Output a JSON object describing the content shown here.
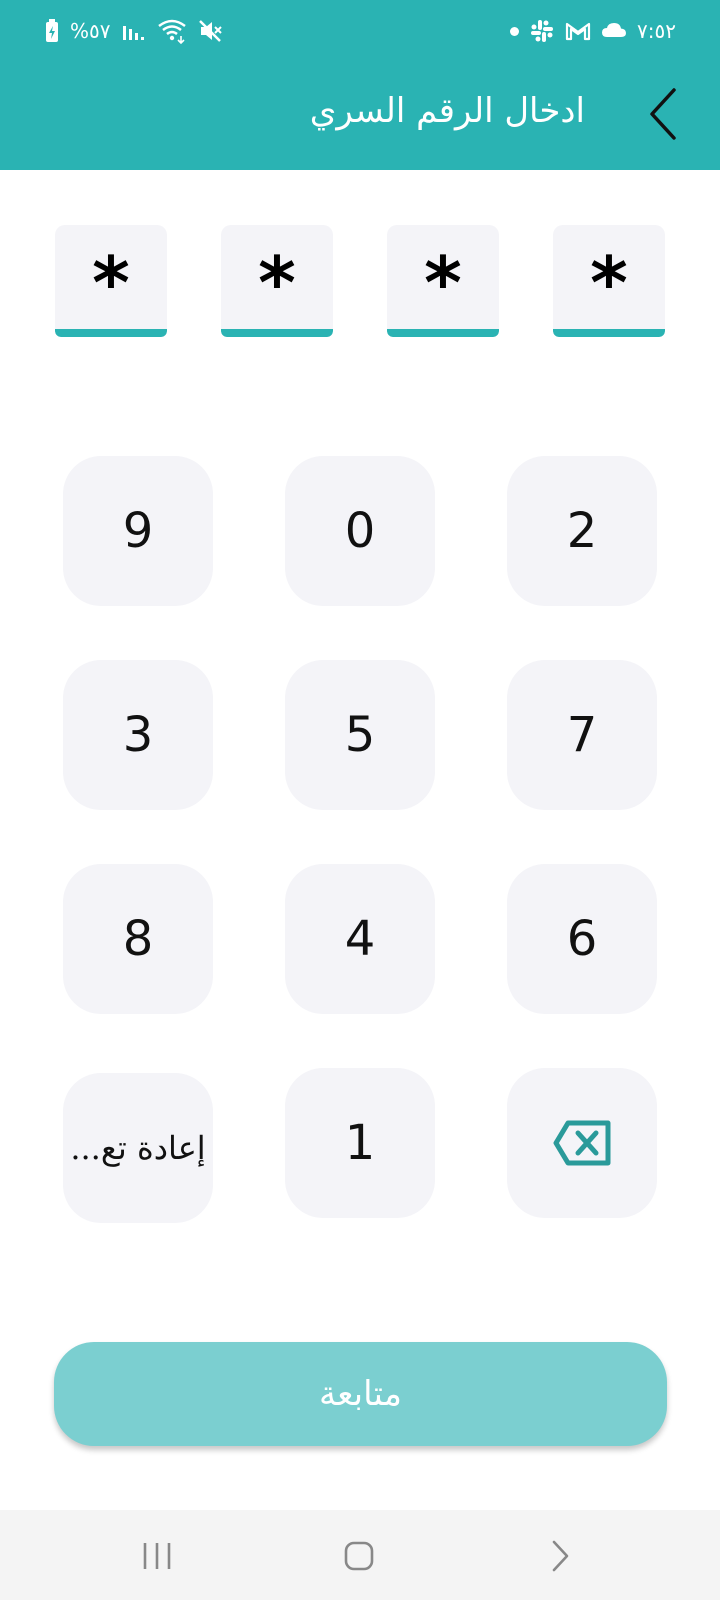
{
  "status_bar": {
    "battery_percent": "%٥٧",
    "time": "٧:٥٢",
    "left_icons": [
      "battery-charging-icon",
      "signal-bars-icon",
      "wifi-icon",
      "mute-icon"
    ],
    "right_icons": [
      "notification-dot-icon",
      "slack-icon",
      "gmail-icon",
      "cloud-icon"
    ]
  },
  "header": {
    "title": "ادخال الرقم السري",
    "back_icon": "chevron-left-icon"
  },
  "pin": {
    "entered_count": 4,
    "mask_char": "*",
    "slots": [
      "*",
      "*",
      "*",
      "*"
    ]
  },
  "keypad": {
    "row1": [
      "9",
      "0",
      "2"
    ],
    "row2": [
      "3",
      "5",
      "7"
    ],
    "row3": [
      "8",
      "4",
      "6"
    ],
    "row4": {
      "retry_label": "إعادة تع...",
      "digit": "1",
      "backspace_icon": "backspace-icon"
    }
  },
  "continue_button": {
    "label": "متابعة",
    "enabled": false
  },
  "nav_bar": {
    "icons": [
      "recent-apps-icon",
      "home-icon",
      "back-icon"
    ]
  },
  "colors": {
    "primary": "#2ab3b3",
    "primary_disabled": "#7bcfd0",
    "key_background": "#f4f4f8",
    "nav_background": "#f4f4f4"
  }
}
